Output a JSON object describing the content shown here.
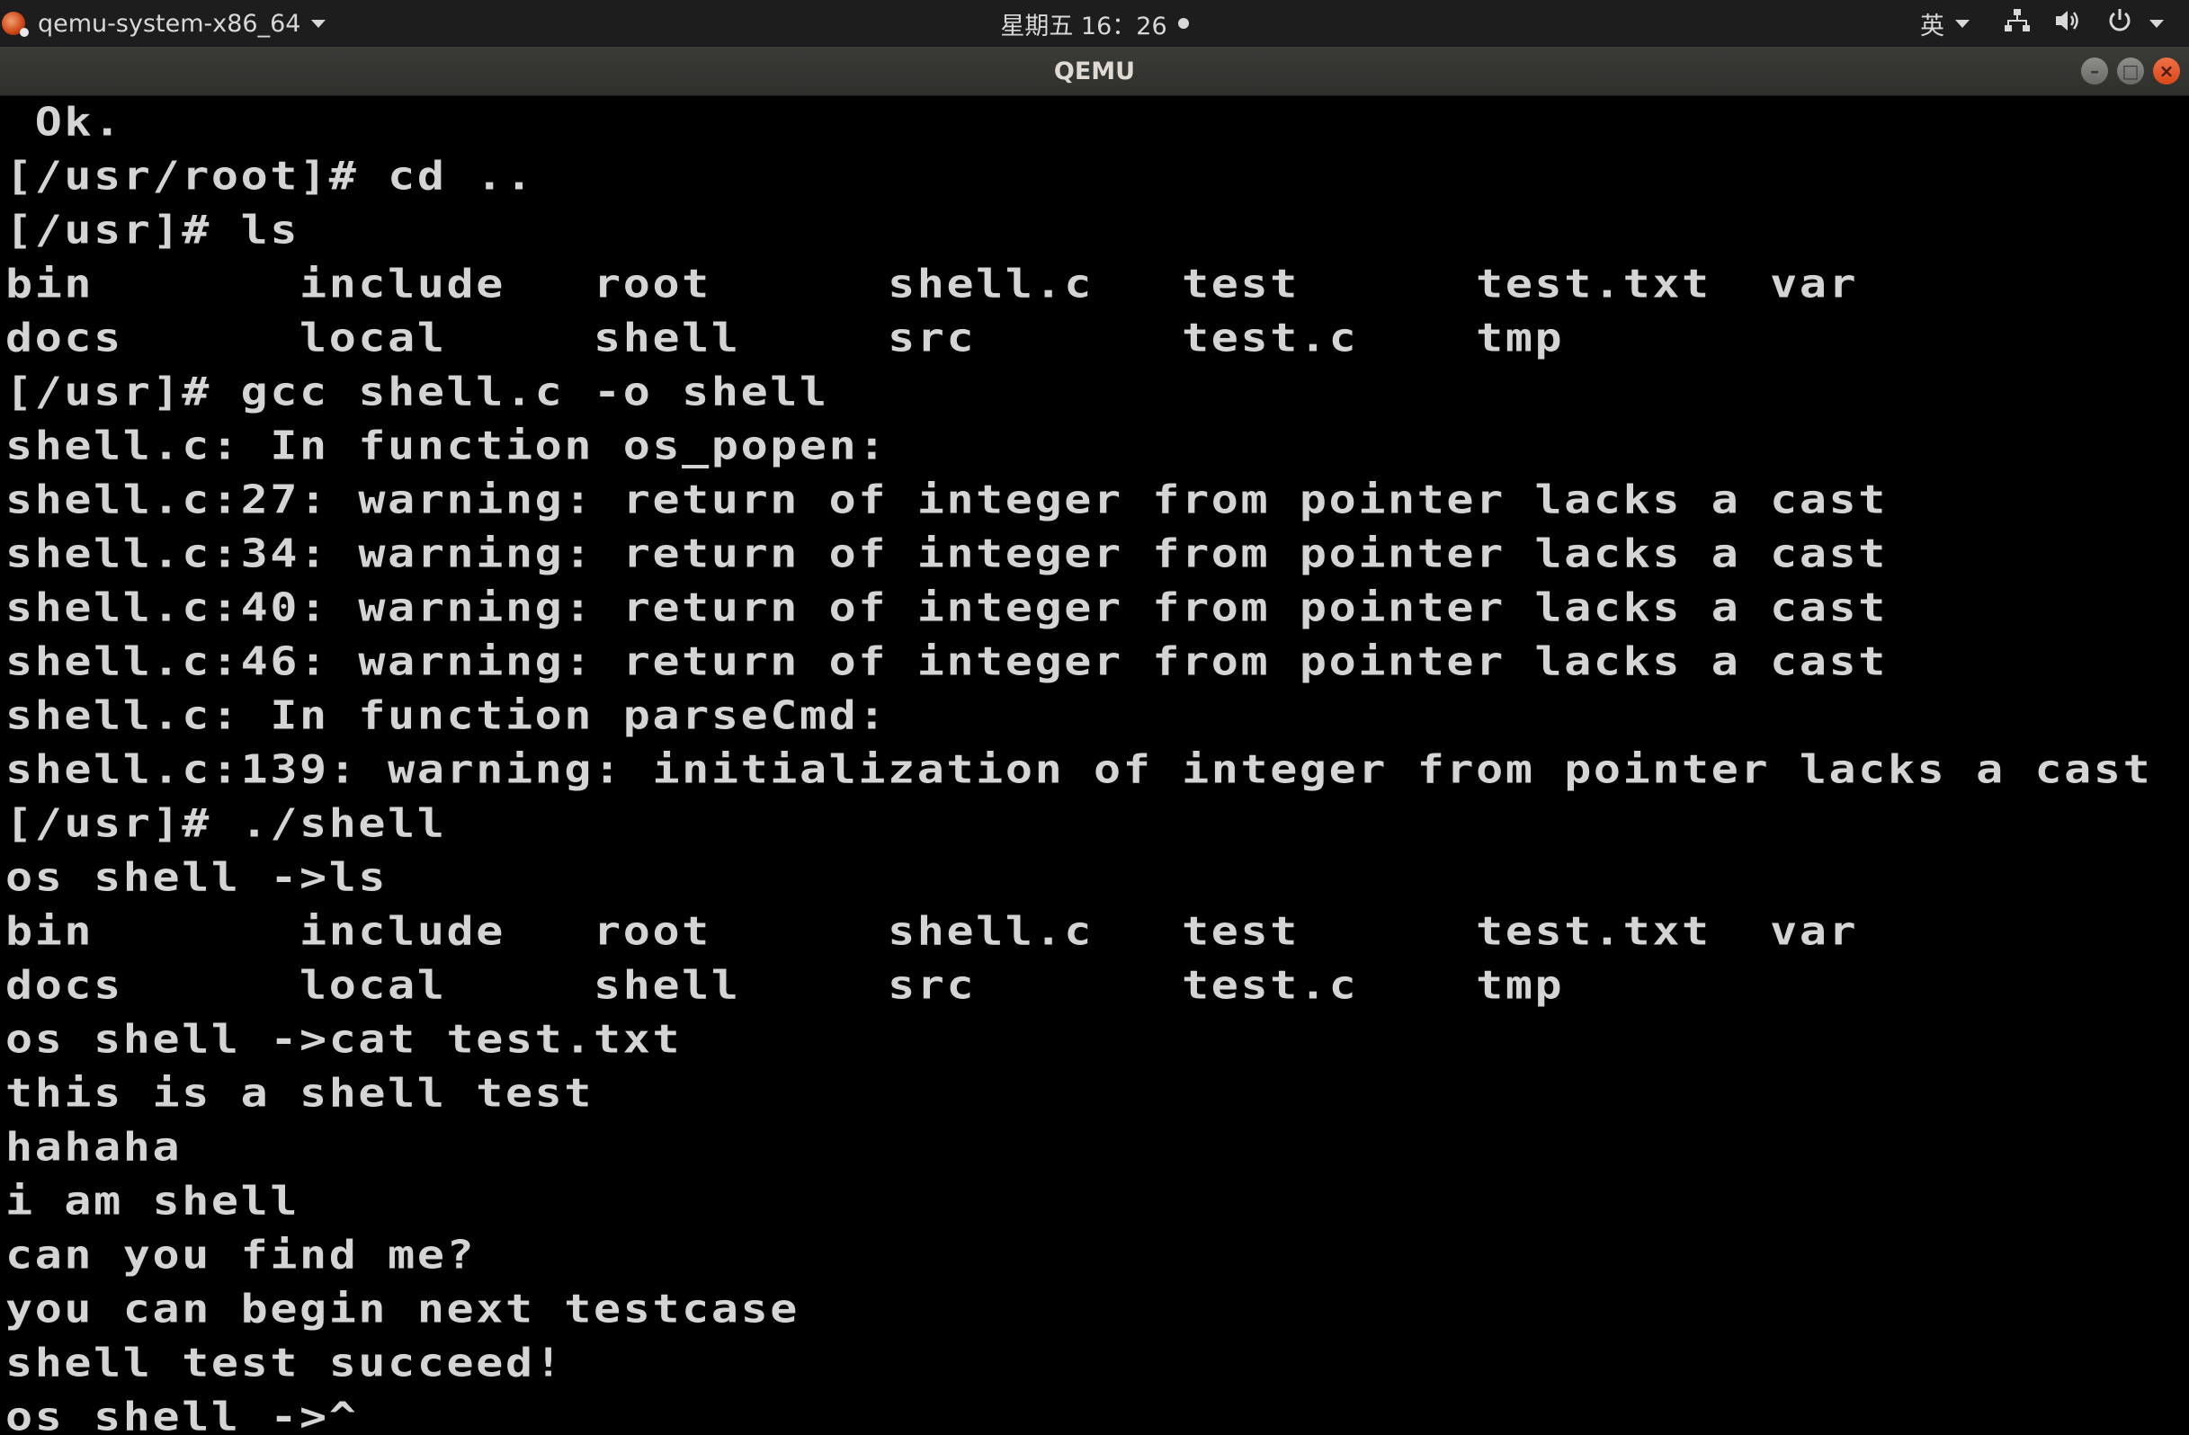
{
  "topbar": {
    "app_name": "qemu-system-x86_64",
    "clock": "星期五 16：26",
    "input_method": "英",
    "icons": {
      "app": "qemu-app-icon",
      "network": "network-icon",
      "volume": "volume-icon",
      "power": "power-icon"
    }
  },
  "window": {
    "title": "QEMU",
    "controls": {
      "minimize": "–",
      "maximize": "□",
      "close": "×"
    }
  },
  "terminal": {
    "lines": [
      " Ok.",
      "[/usr/root]# cd ..",
      "[/usr]# ls",
      "bin       include   root      shell.c   test      test.txt  var",
      "docs      local     shell     src       test.c    tmp",
      "[/usr]# gcc shell.c -o shell",
      "shell.c: In function os_popen:",
      "shell.c:27: warning: return of integer from pointer lacks a cast",
      "shell.c:34: warning: return of integer from pointer lacks a cast",
      "shell.c:40: warning: return of integer from pointer lacks a cast",
      "shell.c:46: warning: return of integer from pointer lacks a cast",
      "shell.c: In function parseCmd:",
      "shell.c:139: warning: initialization of integer from pointer lacks a cast",
      "[/usr]# ./shell",
      "os shell ->ls",
      "bin       include   root      shell.c   test      test.txt  var",
      "docs      local     shell     src       test.c    tmp",
      "os shell ->cat test.txt",
      "this is a shell test",
      "hahaha",
      "i am shell",
      "can you find me?",
      "you can begin next testcase",
      "shell test succeed!",
      "os shell ->^_"
    ]
  }
}
